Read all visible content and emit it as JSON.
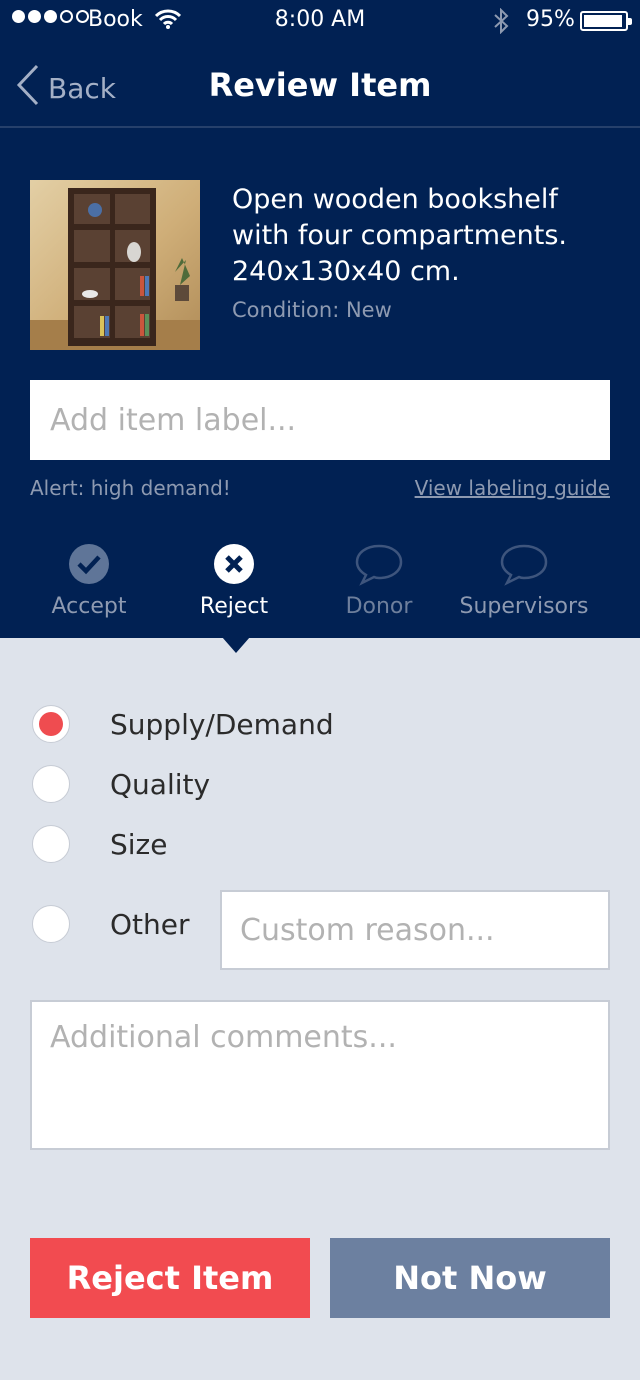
{
  "status_bar": {
    "carrier": "Book",
    "time": "8:00 AM",
    "battery_percent": "95%",
    "battery_level": 0.95,
    "signal_bars_filled": 3,
    "signal_bars_total": 5
  },
  "nav": {
    "back_label": "Back",
    "title": "Review Item"
  },
  "item": {
    "description": "Open wooden bookshelf with four compartments. 240x130x40 cm.",
    "condition": "Condition: New",
    "image_icon": "bookshelf-photo"
  },
  "label_input": {
    "placeholder": "Add item label...",
    "value": ""
  },
  "alert_text": "Alert: high demand!",
  "guide_link": "View labeling guide",
  "tabs": [
    {
      "label": "Accept",
      "icon": "checkmark-circle-icon"
    },
    {
      "label": "Reject",
      "icon": "x-circle-icon",
      "active": true
    },
    {
      "label": "Donor",
      "icon": "speech-bubble-icon"
    },
    {
      "label": "Supervisors",
      "icon": "speech-bubble-icon"
    }
  ],
  "reasons": [
    {
      "label": "Supply/Demand",
      "checked": true
    },
    {
      "label": "Quality",
      "checked": false
    },
    {
      "label": "Size",
      "checked": false
    },
    {
      "label": "Other",
      "checked": false
    }
  ],
  "custom_reason": {
    "placeholder": "Custom reason..."
  },
  "comments": {
    "placeholder": "Additional comments..."
  },
  "buttons": {
    "reject": "Reject Item",
    "not_now": "Not Now"
  },
  "colors": {
    "header_bg": "#012153",
    "page_bg": "#dee3eb",
    "reject_red": "#f24b50",
    "not_now_gray": "#6c80a0",
    "muted_text": "#8e9ab1"
  }
}
